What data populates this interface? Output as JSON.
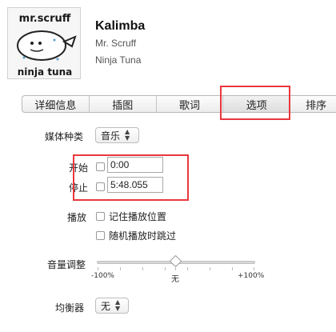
{
  "track": {
    "title": "Kalimba",
    "artist": "Mr. Scruff",
    "album": "Ninja Tuna",
    "artwork_top_text": "mr.scruff",
    "artwork_bottom_text": "ninja tuna"
  },
  "tabs": [
    {
      "label": "详细信息"
    },
    {
      "label": "插图"
    },
    {
      "label": "歌词"
    },
    {
      "label": "选项",
      "selected": true
    },
    {
      "label": "排序"
    }
  ],
  "options": {
    "media_kind_label": "媒体种类",
    "media_kind_value": "音乐",
    "start_label": "开始",
    "start_value": "0:00",
    "start_checked": false,
    "stop_label": "停止",
    "stop_value": "5:48.055",
    "stop_checked": false,
    "playback_label": "播放",
    "remember_position": "记住播放位置",
    "remember_checked": false,
    "skip_shuffle": "随机播放时跳过",
    "skip_checked": false,
    "volume_label": "音量调整",
    "volume_min": "-100%",
    "volume_mid": "无",
    "volume_max": "+100%",
    "volume_value_percent": 0,
    "eq_label": "均衡器",
    "eq_value": "无"
  },
  "colors": {
    "highlight": "#e8383d"
  }
}
